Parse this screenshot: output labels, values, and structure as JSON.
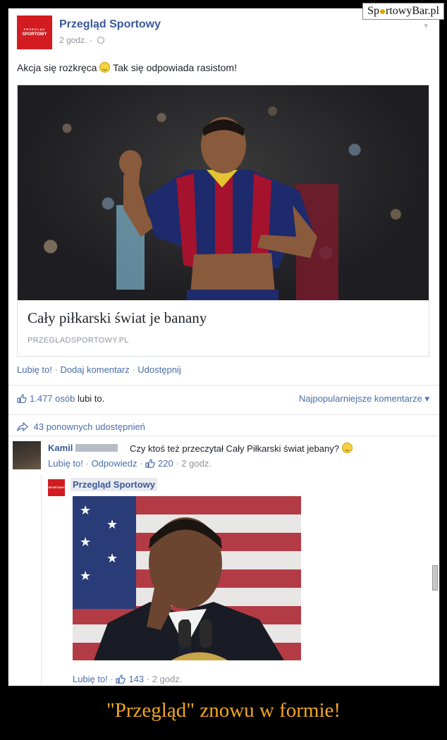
{
  "watermark": {
    "text_left": "Sp",
    "text_right": "rtowyBar.pl"
  },
  "post": {
    "logo_small": "PRZEGLĄD",
    "logo_text": "SPORTOWY",
    "page_name": "Przegląd Sportowy",
    "time": "2 godz. ·",
    "text_before": "Akcja się rozkręca",
    "text_after": " Tak się odpowiada rasistom!",
    "link": {
      "title": "Cały piłkarski świat je banany",
      "domain": "PRZEGLADSPORTOWY.PL"
    },
    "actions": {
      "like": "Lubię to!",
      "sep": " · ",
      "comment": "Dodaj komentarz",
      "share": "Udostępnij"
    },
    "likes_count": "1.477 osób",
    "likes_suffix": " lubi to.",
    "sort": "Najpopularniejsze komentarze ▾",
    "shares": "43 ponownych udostępnień"
  },
  "comment": {
    "author": "Kamil",
    "text": "Czy ktoś też przeczytał Cały Piłkarski świat jebany?",
    "like": "Lubię to!",
    "sep": " · ",
    "reply": "Odpowiedz",
    "likes": "220",
    "time": " · 2 godz."
  },
  "reply": {
    "logo_text": "SPORTOWY",
    "author": "Przegląd Sportowy",
    "like": "Lubię to!",
    "sep": " · ",
    "likes": "143",
    "time": " · 2 godz."
  },
  "caption": "\"Przegląd\" znowu w formie!",
  "colors": {
    "link_blue": "#3b5998",
    "brand_red": "#d21c21",
    "caption": "#f3a81a"
  }
}
